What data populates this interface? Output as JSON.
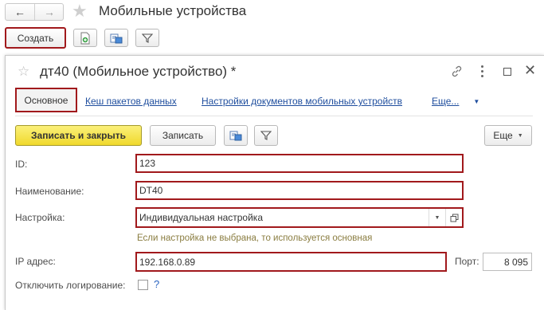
{
  "window": {
    "title": "Мобильные устройства",
    "create_label": "Создать"
  },
  "form": {
    "title": "дт40 (Мобильное устройство) *",
    "tabs": [
      {
        "label": "Основное"
      },
      {
        "label": "Кеш пакетов данных"
      },
      {
        "label": "Настройки документов мобильных устройств"
      },
      {
        "label": "Еще..."
      }
    ],
    "toolbar": {
      "save_close_label": "Записать и закрыть",
      "save_label": "Записать",
      "more_label": "Еще"
    },
    "fields": {
      "id": {
        "label": "ID:",
        "value": "123"
      },
      "name": {
        "label": "Наименование:",
        "value": "DT40"
      },
      "setting": {
        "label": "Настройка:",
        "value": "Индивидуальная настройка"
      },
      "hint": "Если настройка не выбрана, то используется основная",
      "ip": {
        "label": "IP адрес:",
        "value": "192.168.0.89"
      },
      "port": {
        "label": "Порт:",
        "value": "8 095"
      },
      "disable_logging": {
        "label": "Отключить логирование:",
        "help": "?"
      }
    }
  },
  "colors": {
    "accent_red": "#a1191c",
    "primary_yellow": "#f4e233",
    "link_blue": "#1f4e9e"
  }
}
